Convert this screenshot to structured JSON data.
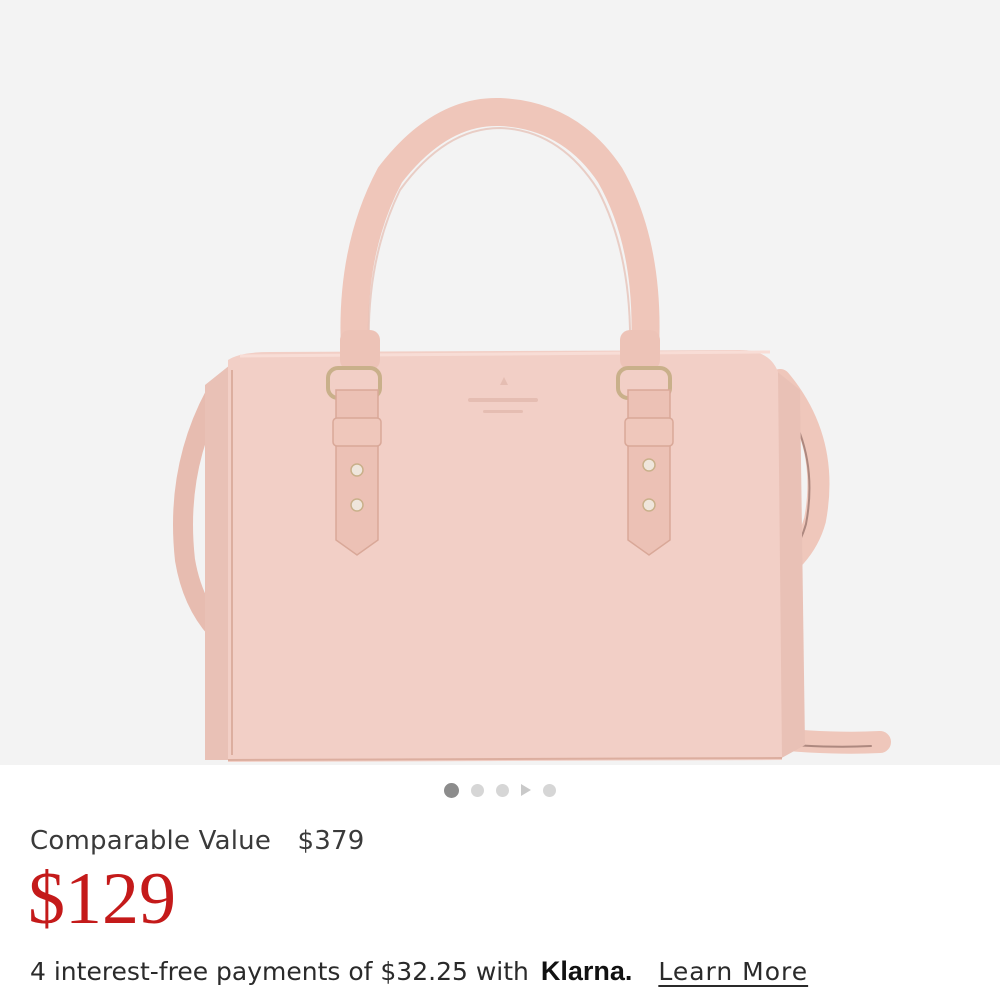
{
  "product": {
    "image_alt": "Pink leather satchel handbag with crossbody strap",
    "comparable_label": "Comparable Value",
    "comparable_value": "$379",
    "price": "$129",
    "installments_text": "4 interest-free payments of $32.25 with",
    "klarna_brand": "Klarna.",
    "learn_more_label": "Learn More"
  },
  "carousel": {
    "total_images": 5,
    "active_index": 0,
    "has_video": true
  },
  "colors": {
    "price_red": "#c41a1a",
    "bag_pink": "#f2cfc6",
    "image_bg": "#f3f3f3"
  }
}
